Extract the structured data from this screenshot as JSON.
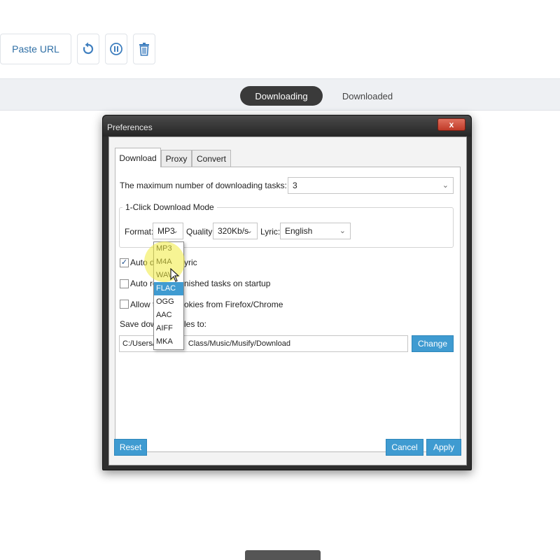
{
  "toolbar": {
    "paste_url_label": "Paste URL",
    "icons": [
      "refresh-icon",
      "pause-icon",
      "trash-icon"
    ]
  },
  "tabs": {
    "downloading": "Downloading",
    "downloaded": "Downloaded"
  },
  "dialog": {
    "title": "Preferences",
    "close_glyph": "x",
    "tabs": [
      "Download",
      "Proxy",
      "Convert"
    ],
    "max_tasks_label": "The maximum number of downloading tasks:",
    "max_tasks_value": "3",
    "group_title": "1-Click Download Mode",
    "format_label": "Format:",
    "format_value": "MP3",
    "quality_label": "Quality:",
    "quality_value": "320Kb/s",
    "lyric_label": "Lyric:",
    "lyric_value": "English",
    "auto_download_lyric_label": "Auto d",
    "auto_download_lyric_suffix": "yric",
    "auto_download_lyric_checked": true,
    "auto_resume_label": "Auto re",
    "auto_resume_suffix": "nished tasks on startup",
    "auto_resume_checked": false,
    "allow_cookies_label": "Allow t",
    "allow_cookies_suffix": "okies from Firefox/Chrome",
    "allow_cookies_checked": false,
    "save_label": "Save dowr",
    "save_label_suffix": "les to:",
    "save_path_prefix": "C:/Users/",
    "save_path_suffix": "Class/Music/Musify/Download",
    "change_button": "Change",
    "reset_button": "Reset",
    "cancel_button": "Cancel",
    "apply_button": "Apply",
    "format_options": [
      "MP3",
      "M4A",
      "WAV",
      "FLAC",
      "OGG",
      "AAC",
      "AIFF",
      "MKA"
    ],
    "highlighted_option": "FLAC"
  },
  "colors": {
    "accent": "#3f9bd1",
    "dark_pill": "#3a3a3a",
    "link_blue": "#2f6fa5"
  }
}
